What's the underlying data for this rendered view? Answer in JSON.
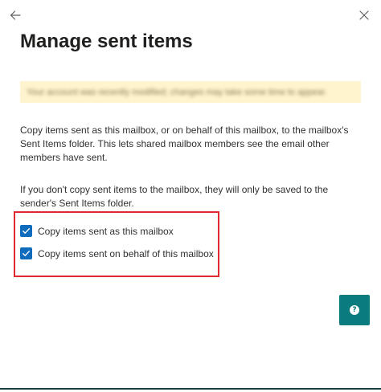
{
  "header": {
    "back_icon": "arrow-left-icon",
    "close_icon": "close-icon"
  },
  "page": {
    "title": "Manage sent items"
  },
  "notice": {
    "text": "Your account was recently modified; changes may take some time to appear."
  },
  "description": {
    "paragraph_1": "Copy items sent as this mailbox, or on behalf of this mailbox, to the mailbox's Sent Items folder. This lets shared mailbox members see the email other members have sent.",
    "paragraph_2": "If you don't copy sent items to the mailbox, they will only be saved to the sender's Sent Items folder."
  },
  "options": [
    {
      "label": "Copy items sent as this mailbox",
      "checked": true
    },
    {
      "label": "Copy items sent on behalf of this mailbox",
      "checked": true
    }
  ],
  "help": {
    "icon": "question-circle-icon",
    "glyph": "?"
  },
  "colors": {
    "checkbox": "#0f6cbd",
    "help_button": "#0a7c80",
    "highlight_border": "#e0282e",
    "notice_background": "#fff4ce"
  }
}
